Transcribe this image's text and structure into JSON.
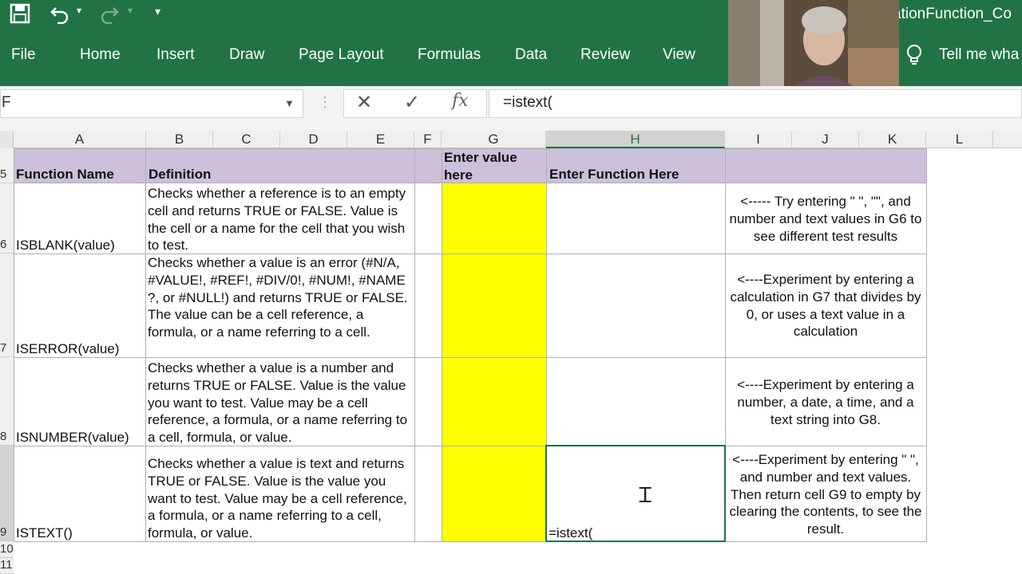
{
  "ribbon": {
    "filename": "ationFunction_Co",
    "tabs": [
      "File",
      "Home",
      "Insert",
      "Draw",
      "Page Layout",
      "Formulas",
      "Data",
      "Review",
      "View"
    ],
    "tell_me": "Tell me wha"
  },
  "formula_bar": {
    "name_box": "F",
    "fx": "fx",
    "formula": "=istext("
  },
  "columns": [
    "A",
    "B",
    "C",
    "D",
    "E",
    "F",
    "G",
    "H",
    "I",
    "J",
    "K",
    "L"
  ],
  "selected_column": "H",
  "rows": [
    "5",
    "6",
    "7",
    "8",
    "9",
    "10",
    "11"
  ],
  "header_row": {
    "function_name": "Function Name",
    "definition": "Definition",
    "enter_value": "Enter value here",
    "enter_function": "Enter Function Here"
  },
  "table": [
    {
      "name": "ISBLANK(value)",
      "definition": "Checks whether a reference is to an empty cell and returns TRUE or FALSE. Value is the cell or a name for the cell that you wish to test.",
      "function_entry": "",
      "hint": "<----- Try entering \" \", \"\", and number and text values in G6 to see different test results"
    },
    {
      "name": "ISERROR(value)",
      "definition": "Checks whether a value is an error (#N/A, #VALUE!, #REF!, #DIV/0!, #NUM!, #NAME ?, or #NULL!) and returns TRUE or FALSE. The value can be a cell reference, a formula, or a name referring to a cell.",
      "function_entry": "",
      "hint": "<----Experiment by entering a calculation in G7 that divides by 0, or uses a text value in a calculation"
    },
    {
      "name": "ISNUMBER(value)",
      "definition": "Checks whether a value is a number and returns TRUE or FALSE. Value is the value you want to test. Value may be a cell reference, a formula, or a name referring to a cell, formula, or value.",
      "function_entry": "",
      "hint": "<----Experiment by entering a number, a date, a time, and a text string into G8."
    },
    {
      "name": "ISTEXT()",
      "definition": "Checks whether a value is text and returns TRUE or FALSE. Value is the value you want to test. Value may be a cell reference, a formula, or a name referring to a cell, formula, or value.",
      "function_entry": "=istext(",
      "hint": "<----Experiment by entering \" \", and number and text values. Then return cell G9 to empty by clearing the contents, to see the result."
    }
  ],
  "colors": {
    "ribbon": "#217346",
    "header_fill": "#ccc0da",
    "input_fill": "#ffff00"
  }
}
